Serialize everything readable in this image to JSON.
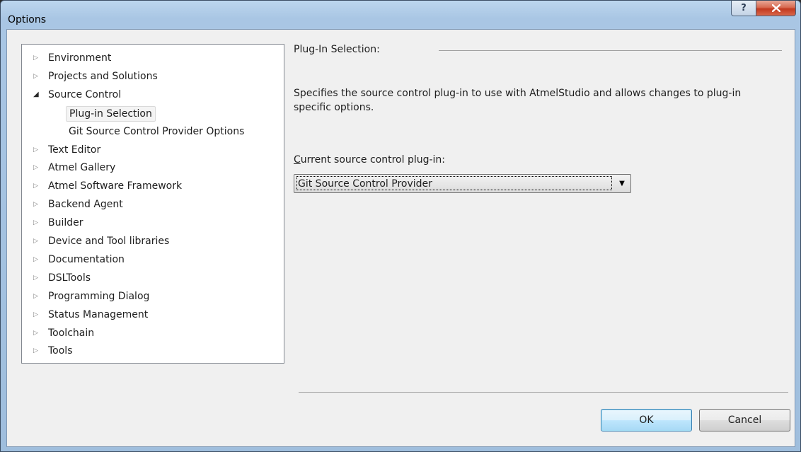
{
  "window": {
    "title": "Options",
    "help_glyph": "?",
    "close_glyph": "x"
  },
  "tree": {
    "items": [
      {
        "label": "Environment",
        "expanded": false
      },
      {
        "label": "Projects and Solutions",
        "expanded": false
      },
      {
        "label": "Source Control",
        "expanded": true
      },
      {
        "label": "Plug-in Selection",
        "child": true,
        "selected": true
      },
      {
        "label": "Git Source Control Provider Options",
        "child": true
      },
      {
        "label": "Text Editor",
        "expanded": false
      },
      {
        "label": "Atmel Gallery",
        "expanded": false
      },
      {
        "label": "Atmel Software Framework",
        "expanded": false
      },
      {
        "label": "Backend Agent",
        "expanded": false
      },
      {
        "label": "Builder",
        "expanded": false
      },
      {
        "label": "Device and Tool libraries",
        "expanded": false
      },
      {
        "label": "Documentation",
        "expanded": false
      },
      {
        "label": "DSLTools",
        "expanded": false
      },
      {
        "label": "Programming Dialog",
        "expanded": false
      },
      {
        "label": "Status Management",
        "expanded": false
      },
      {
        "label": "Toolchain",
        "expanded": false
      },
      {
        "label": "Tools",
        "expanded": false
      }
    ],
    "collapsed_glyph": "▷",
    "expanded_glyph": "◢"
  },
  "panel": {
    "title": "Plug-In Selection:",
    "description": "Specifies the source control plug-in to use with AtmelStudio and allows changes to plug-in specific options.",
    "combo_label_accel": "C",
    "combo_label_rest": "urrent source control plug-in:",
    "combo_value": "Git Source Control Provider",
    "combo_arrow_glyph": "▼"
  },
  "buttons": {
    "ok": "OK",
    "cancel": "Cancel"
  }
}
